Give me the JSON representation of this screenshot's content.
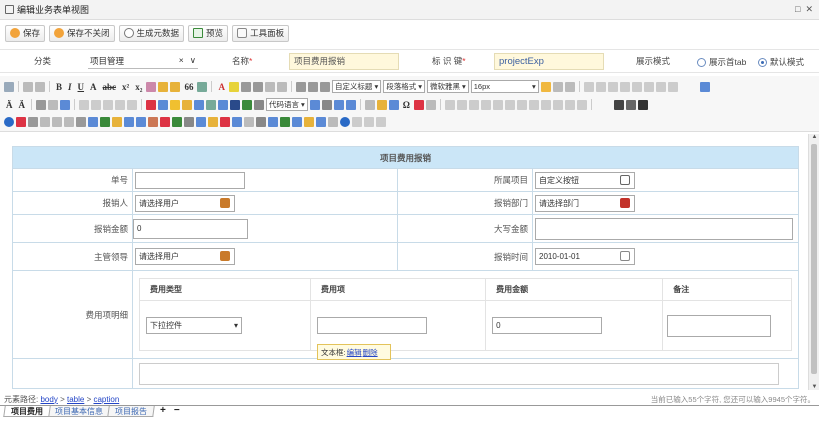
{
  "window": {
    "title": "编辑业务表单视图",
    "controls": [
      "□",
      "✕"
    ]
  },
  "toolbar": {
    "save": "保存",
    "save_keep": "保存不关闭",
    "generate": "生成元数据",
    "preview": "预览",
    "tools": "工具面板"
  },
  "form": {
    "category_label": "分类",
    "category_value": "项目管理",
    "category_clear": "×",
    "category_arrow": "∨",
    "name_label": "名称",
    "name_value": "项目费用报销",
    "key_label": "标 识 键",
    "key_value": "projectExp",
    "required_mark": "*",
    "display_label": "展示模式",
    "display_options": [
      "展示首tab",
      "默认模式"
    ],
    "display_selected": "默认模式"
  },
  "editor_toolbar": {
    "custom_label": "自定义标题",
    "paragraph": "段落格式",
    "font": "微软雅黑",
    "size": "16px",
    "code_lang": "代码语言"
  },
  "doc": {
    "caption": "项目费用报销",
    "fields": {
      "doc_no": "单号",
      "project": "所属项目",
      "project_value": "自定义按钮",
      "applicant": "报销人",
      "applicant_value": "请选择用户",
      "dept": "报销部门",
      "dept_value": "请选择部门",
      "amount": "报销金额",
      "amount_value": "0",
      "amount_cn": "大写金额",
      "manager": "主管领导",
      "manager_value": "请选择用户",
      "time": "报销时间",
      "time_value": "2010-01-01",
      "detail": "费用项明细"
    },
    "subtable": {
      "headers": [
        "费用类型",
        "费用项",
        "费用金额",
        "备注"
      ],
      "row": {
        "type_select": "下拉控件",
        "amount": "0"
      }
    }
  },
  "tooltip": {
    "prefix": "文本框:",
    "edit": "编辑",
    "delete": "删除"
  },
  "status": {
    "path_label": "元素路径:",
    "path": [
      "body",
      "table",
      "caption"
    ],
    "path_sep": ">",
    "count": "当前已输入55个字符, 您还可以输入9945个字符。"
  },
  "tabs": {
    "items": [
      "项目费用",
      "项目基本信息",
      "项目报告"
    ],
    "active": "项目费用",
    "add": "+",
    "remove": "−"
  },
  "colors": {
    "caption_bg": "#cbe6f7",
    "input_highlight": "#fff8dc",
    "link": "#2345c7"
  }
}
